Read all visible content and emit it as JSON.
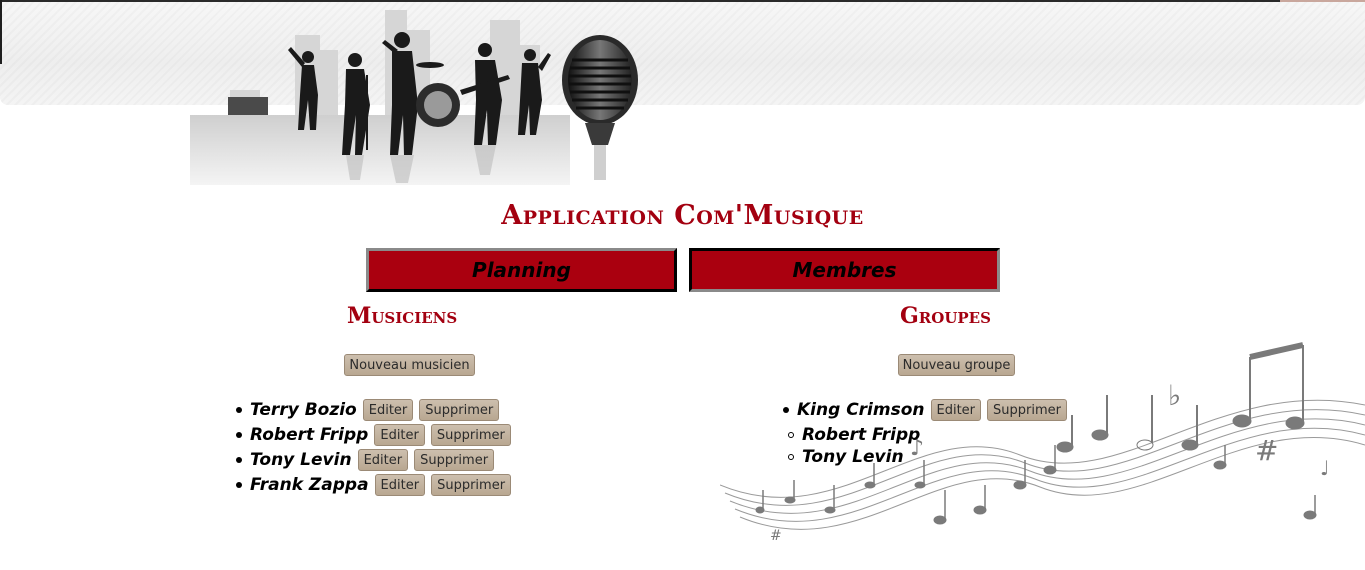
{
  "app": {
    "title": "Application Com'Musique"
  },
  "nav": {
    "planning_label": "Planning",
    "membres_label": "Membres"
  },
  "musiciens": {
    "title": "Musiciens",
    "new_button": "Nouveau musicien",
    "items": [
      {
        "name": "Terry Bozio"
      },
      {
        "name": "Robert Fripp"
      },
      {
        "name": "Tony Levin"
      },
      {
        "name": "Frank Zappa"
      }
    ]
  },
  "groupes": {
    "title": "Groupes",
    "new_button": "Nouveau groupe",
    "items": [
      {
        "name": "King Crimson",
        "members": [
          "Robert Fripp",
          "Tony Levin"
        ]
      }
    ]
  },
  "actions": {
    "edit": "Editer",
    "delete": "Supprimer"
  },
  "colors": {
    "accent": "#a30010",
    "nav_bg": "#aa000f",
    "button_bg": "#c4b49f"
  }
}
